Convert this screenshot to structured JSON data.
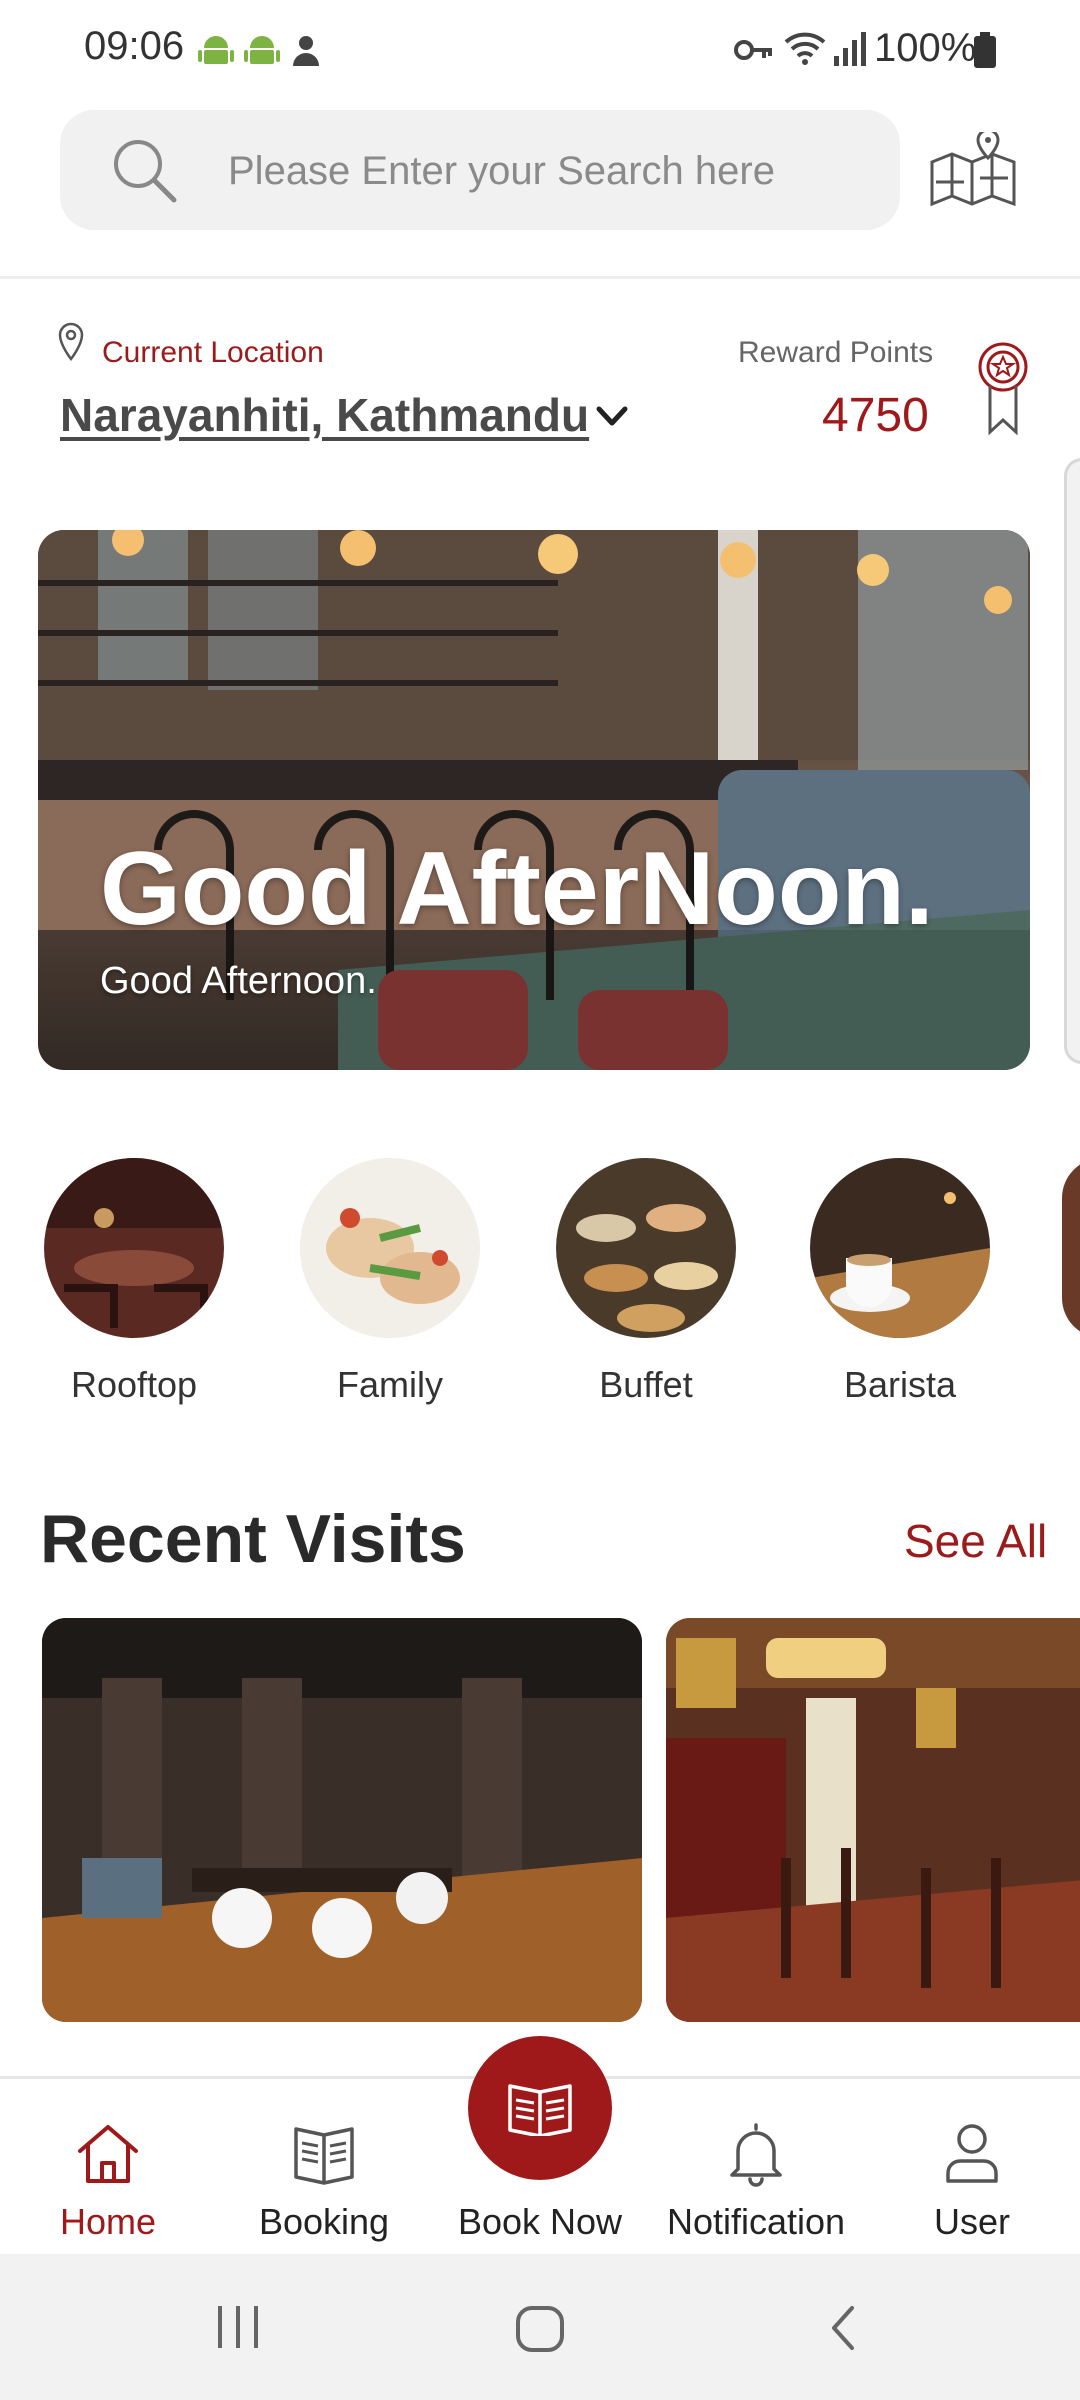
{
  "status_bar": {
    "time": "09:06",
    "battery": "100%"
  },
  "search": {
    "placeholder": "Please Enter your Search here"
  },
  "location": {
    "label": "Current Location",
    "value": "Narayanhiti, Kathmandu"
  },
  "rewards": {
    "label": "Reward Points",
    "value": "4750"
  },
  "banner": {
    "title": "Good AfterNoon.",
    "subtitle": "Good Afternoon."
  },
  "categories": [
    {
      "label": "Rooftop"
    },
    {
      "label": "Family"
    },
    {
      "label": "Buffet"
    },
    {
      "label": "Barista"
    }
  ],
  "recent_visits": {
    "title": "Recent Visits",
    "see_all": "See All"
  },
  "bottom_nav": {
    "home": "Home",
    "booking": "Booking",
    "book_now": "Book Now",
    "notification": "Notification",
    "user": "User"
  },
  "colors": {
    "accent": "#a0191a",
    "text": "#222222"
  }
}
